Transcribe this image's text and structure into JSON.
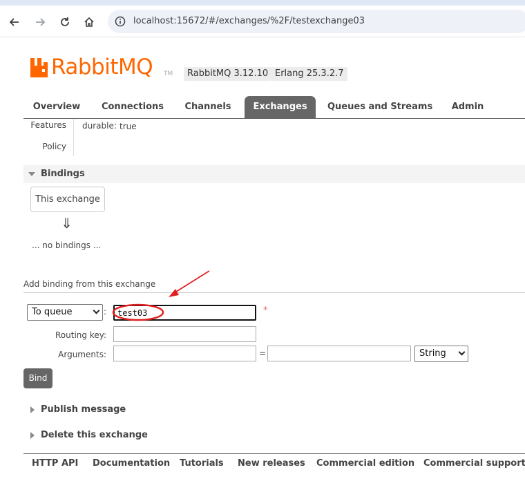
{
  "browser": {
    "url": "localhost:15672/#/exchanges/%2F/testexchange03",
    "icons": [
      "back-arrow-icon",
      "forward-arrow-icon",
      "reload-icon",
      "home-icon",
      "site-info-icon"
    ]
  },
  "header": {
    "logo_text": "RabbitMQ",
    "logo_tm": "TM",
    "rabbitmq_version": "RabbitMQ 3.12.10",
    "erlang_version": "Erlang 25.3.2.7",
    "brand_color": "#ff6600"
  },
  "tabs": [
    {
      "label": "Overview",
      "active": false
    },
    {
      "label": "Connections",
      "active": false
    },
    {
      "label": "Channels",
      "active": false
    },
    {
      "label": "Exchanges",
      "active": true
    },
    {
      "label": "Queues and Streams",
      "active": false
    },
    {
      "label": "Admin",
      "active": false
    }
  ],
  "properties": {
    "features_label": "Features",
    "features_key": "durable:",
    "features_value": "true",
    "policy_label": "Policy"
  },
  "bindings": {
    "title": "Bindings",
    "this_exchange": "This exchange",
    "arrow": "⇓",
    "empty_text": "... no bindings ..."
  },
  "add_binding": {
    "title": "Add binding from this exchange",
    "destination_type": "To queue",
    "destination_colon": ":",
    "destination_value": "test03",
    "required_mark": "*",
    "routing_key_label": "Routing key:",
    "routing_key_value": "",
    "arguments_label": "Arguments:",
    "argument_key": "",
    "equals": "=",
    "argument_value": "",
    "argument_type": "String",
    "bind_button": "Bind"
  },
  "sections": {
    "publish_message": "Publish message",
    "delete_exchange": "Delete this exchange"
  },
  "footer": {
    "links": [
      "HTTP API",
      "Documentation",
      "Tutorials",
      "New releases",
      "Commercial edition",
      "Commercial support"
    ]
  },
  "annotation_color": "#e02020"
}
